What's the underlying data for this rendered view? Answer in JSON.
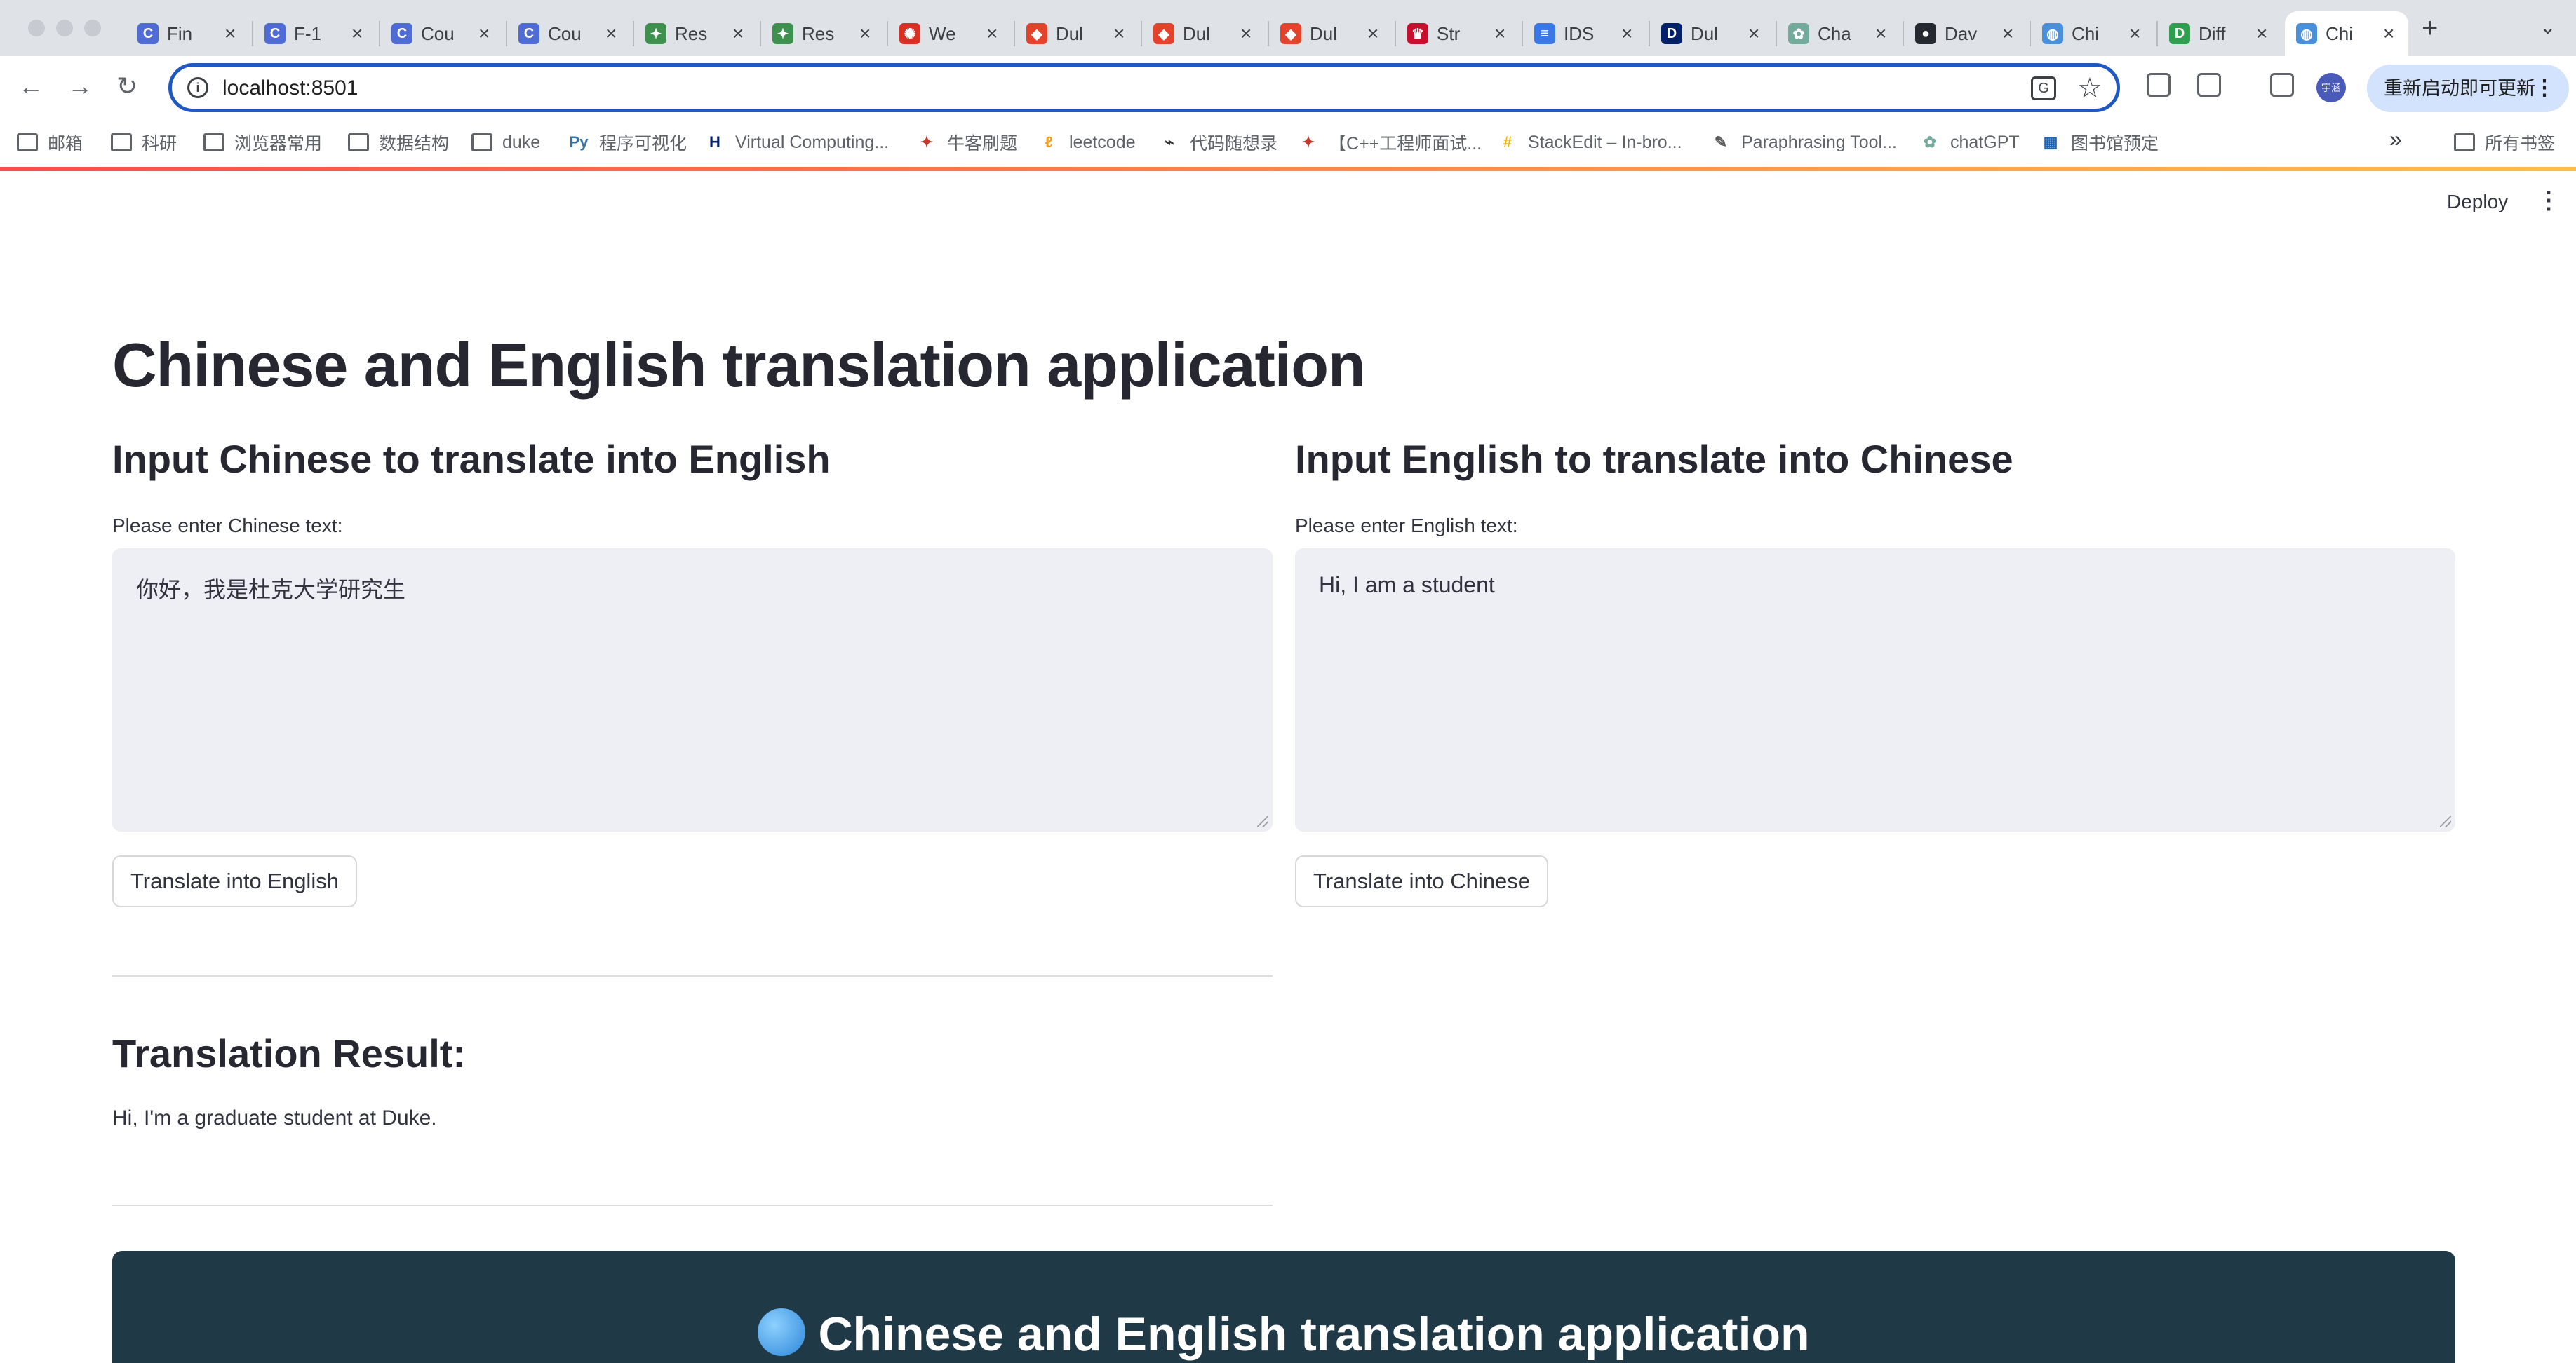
{
  "browser": {
    "tabs": [
      {
        "label": "Fin",
        "favicon": "C",
        "color": "#4f6bd6"
      },
      {
        "label": "F-1",
        "favicon": "C",
        "color": "#4f6bd6"
      },
      {
        "label": "Cou",
        "favicon": "C",
        "color": "#4f6bd6"
      },
      {
        "label": "Cou",
        "favicon": "C",
        "color": "#4f6bd6"
      },
      {
        "label": "Res",
        "favicon": "✦",
        "color": "#3f8f4f"
      },
      {
        "label": "Res",
        "favicon": "✦",
        "color": "#3f8f4f"
      },
      {
        "label": "We",
        "favicon": "✺",
        "color": "#d93025"
      },
      {
        "label": "Dul",
        "favicon": "◆",
        "color": "#e2432a"
      },
      {
        "label": "Dul",
        "favicon": "◆",
        "color": "#e2432a"
      },
      {
        "label": "Dul",
        "favicon": "◆",
        "color": "#e2432a"
      },
      {
        "label": "Str",
        "favicon": "♛",
        "color": "#c8102e"
      },
      {
        "label": "IDS",
        "favicon": "≡",
        "color": "#3b78e7"
      },
      {
        "label": "Dul",
        "favicon": "D",
        "color": "#012169"
      },
      {
        "label": "Cha",
        "favicon": "✿",
        "color": "#74aa9c"
      },
      {
        "label": "Dav",
        "favicon": "●",
        "color": "#24292f"
      },
      {
        "label": "Chi",
        "favicon": "◍",
        "color": "#4a8fd9"
      },
      {
        "label": "Diff",
        "favicon": "D",
        "color": "#2e9e4f"
      },
      {
        "label": "Chi",
        "favicon": "◍",
        "color": "#4a8fd9"
      }
    ],
    "url": "localhost:8501",
    "update_button": "重新启动即可更新",
    "avatar_text": "宇涵",
    "bookmarks": [
      {
        "label": "邮箱",
        "icon": "folder-icon"
      },
      {
        "label": "科研",
        "icon": "folder-icon"
      },
      {
        "label": "浏览器常用",
        "icon": "folder-icon"
      },
      {
        "label": "数据结构",
        "icon": "folder-icon"
      },
      {
        "label": "duke",
        "icon": "folder-icon"
      },
      {
        "label": "程序可视化",
        "icon": "python-icon"
      },
      {
        "label": "Virtual Computing...",
        "icon": "duke-icon"
      },
      {
        "label": "牛客刷题",
        "icon": "nowcoder-icon"
      },
      {
        "label": "leetcode",
        "icon": "leetcode-icon"
      },
      {
        "label": "代码随想录",
        "icon": "code-icon"
      },
      {
        "label": "【C++工程师面试...",
        "icon": "nowcoder-icon"
      },
      {
        "label": "StackEdit – In-bro...",
        "icon": "stackedit-icon"
      },
      {
        "label": "Paraphrasing Tool...",
        "icon": "feather-icon"
      },
      {
        "label": "chatGPT",
        "icon": "chatgpt-icon"
      },
      {
        "label": "图书馆预定",
        "icon": "library-icon"
      }
    ],
    "all_bookmarks": "所有书签"
  },
  "app": {
    "deploy_label": "Deploy",
    "title": "Chinese and English translation application",
    "left": {
      "heading": "Input Chinese to translate into English",
      "field_label": "Please enter Chinese text:",
      "value": "你好，我是杜克大学研究生",
      "button": "Translate into English"
    },
    "right": {
      "heading": "Input English to translate into Chinese",
      "field_label": "Please enter English text:",
      "value": "Hi, I am a student",
      "button": "Translate into Chinese"
    },
    "result": {
      "heading": "Translation Result:",
      "text": "Hi, I'm a graduate student at Duke."
    },
    "footer_title": "Chinese and English translation application"
  }
}
